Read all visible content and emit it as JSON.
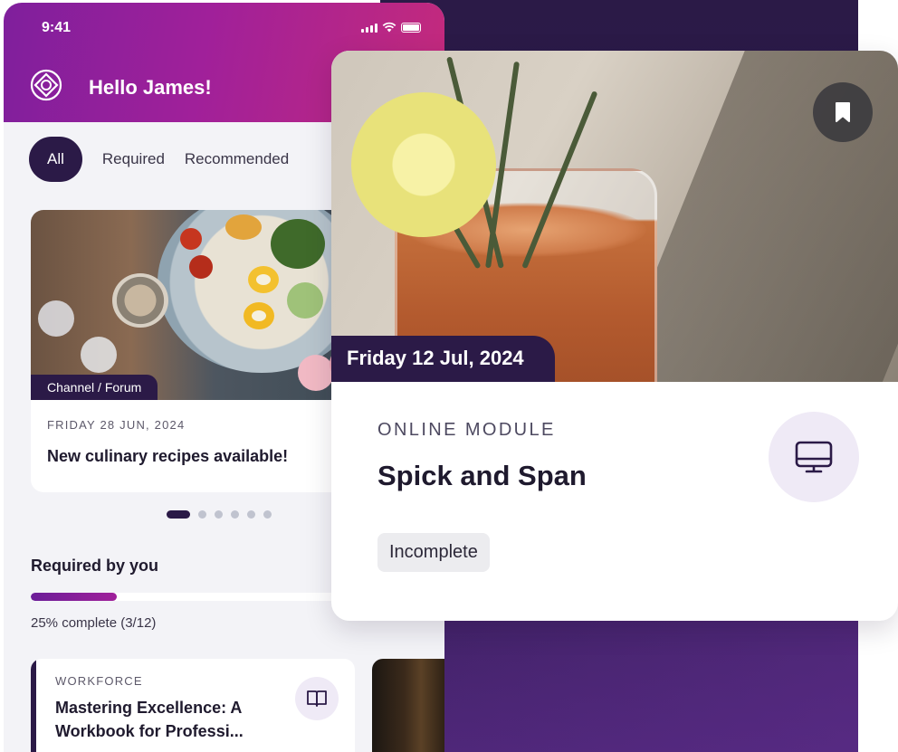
{
  "status_bar": {
    "time": "9:41"
  },
  "header": {
    "greeting": "Hello James!"
  },
  "tabs": [
    {
      "label": "All",
      "active": true
    },
    {
      "label": "Required",
      "active": false
    },
    {
      "label": "Recommended",
      "active": false
    }
  ],
  "news_card": {
    "badge": "Channel / Forum",
    "date": "FRIDAY 28 JUN, 2024",
    "title": "New culinary recipes available!"
  },
  "carousel": {
    "total": 6,
    "active_index": 0
  },
  "required": {
    "title": "Required by you",
    "progress_fraction": 0.25,
    "progress_text": "25% complete (3/12)"
  },
  "course_card": {
    "category": "WORKFORCE",
    "title": "Mastering Excellence: A Workbook for Professi...",
    "icon": "book-icon"
  },
  "module_card": {
    "date": "Friday 12 Jul, 2024",
    "type": "ONLINE MODULE",
    "title": "Spick and Span",
    "status": "Incomplete",
    "icon": "monitor-icon",
    "bookmark_icon": "bookmark-icon"
  },
  "colors": {
    "brand_dark": "#2b1a47",
    "header_gradient_start": "#7f1f9c",
    "header_gradient_end": "#c42a7c",
    "icon_bg": "#efeaf6"
  }
}
